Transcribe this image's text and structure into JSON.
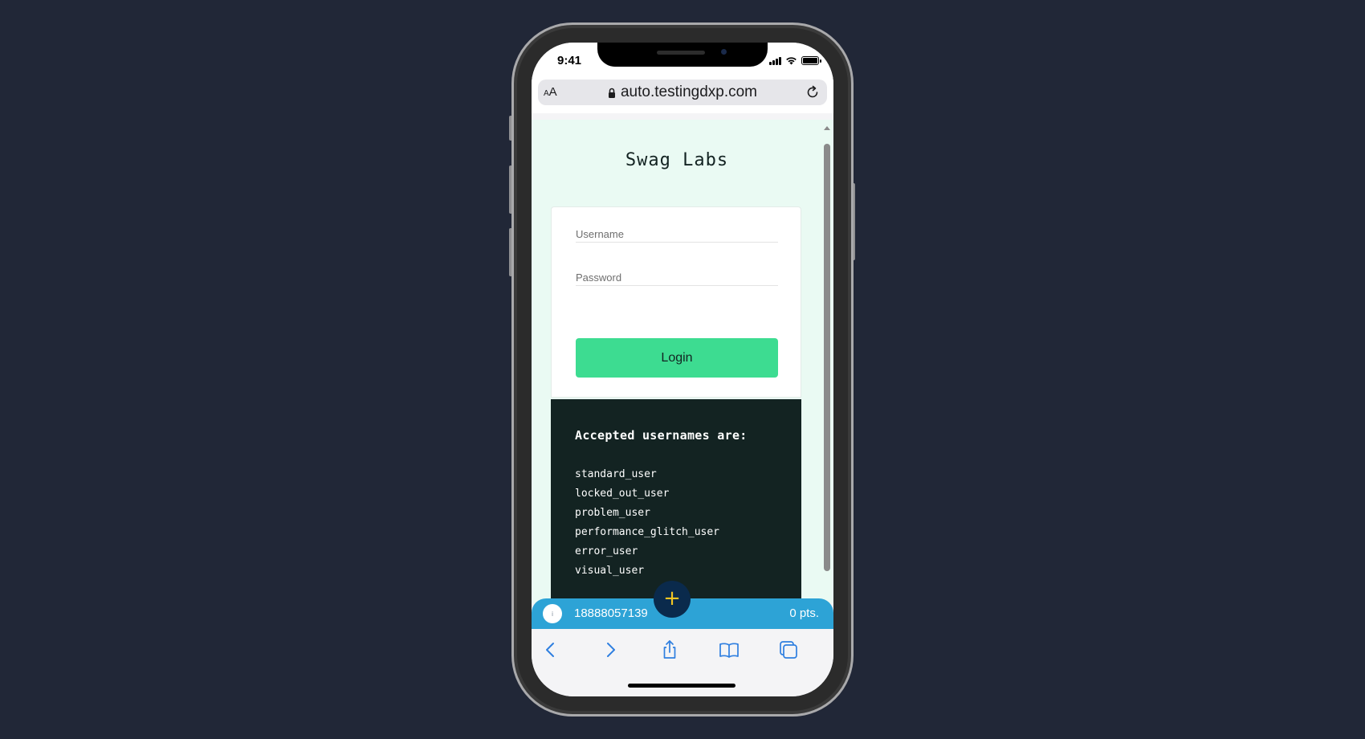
{
  "status_bar": {
    "time": "9:41"
  },
  "browser": {
    "text_size_small": "A",
    "text_size_big": "A",
    "url": "auto.testingdxp.com"
  },
  "page": {
    "logo": "Swag Labs",
    "username_placeholder": "Username",
    "password_placeholder": "Password",
    "login_label": "Login",
    "credentials": {
      "title": "Accepted usernames are:",
      "usernames": [
        "standard_user",
        "locked_out_user",
        "problem_user",
        "performance_glitch_user",
        "error_user",
        "visual_user"
      ]
    }
  },
  "fab": {
    "label": "+"
  },
  "points_bar": {
    "avatar_glyph": "i",
    "phone": "18888057139",
    "points": "0 pts."
  },
  "colors": {
    "page_background": "#212737",
    "web_background": "#eafaf3",
    "login_button": "#3ddc91",
    "credentials_background": "#132322",
    "points_bar": "#2da3d6",
    "fab": "#0a2a4c",
    "fab_plus": "#f3c623",
    "toolbar_icon": "#2f7fe0"
  },
  "icons": {
    "lock": "lock-icon",
    "reload": "reload-icon",
    "back": "chevron-left-icon",
    "forward": "chevron-right-icon",
    "share": "share-icon",
    "bookmarks": "book-icon",
    "tabs": "tabs-icon"
  }
}
